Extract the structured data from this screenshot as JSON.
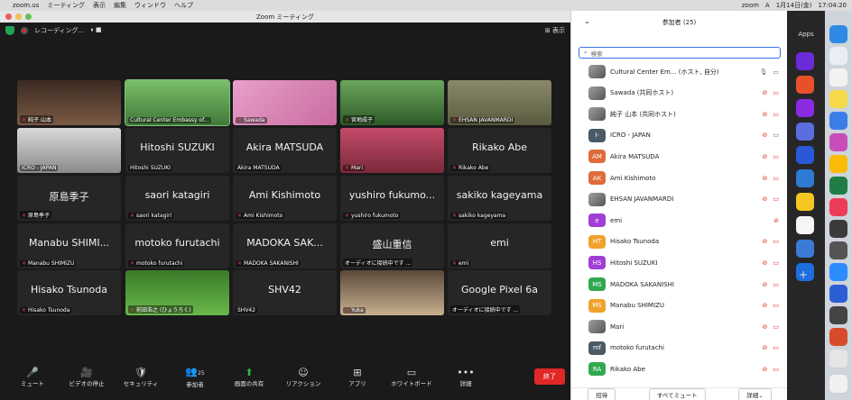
{
  "menubar": {
    "apple": "",
    "items": [
      "zoom.us",
      "ミーティング",
      "表示",
      "編集",
      "ウィンドウ",
      "ヘルプ"
    ],
    "right_items": [
      "zoom",
      "A",
      "1月14日(金)",
      "17:04:20"
    ]
  },
  "window": {
    "title": "Zoom ミーティング"
  },
  "topbar": {
    "recording": "レコーディング...",
    "pause": "⏸ ■",
    "view": "表示"
  },
  "tiles": [
    {
      "big": "",
      "name": "純子 山本",
      "muted": true
    },
    {
      "big": "",
      "name": "Cultural Center Embassy of...",
      "muted": false,
      "highlight": true
    },
    {
      "big": "",
      "name": "Sawada",
      "muted": true
    },
    {
      "big": "",
      "name": "宮地成子",
      "muted": true
    },
    {
      "big": "",
      "name": "EHSAN JAVANMARDI",
      "muted": true
    },
    {
      "big": "",
      "name": "ICRO - JAPAN",
      "muted": false
    },
    {
      "big": "Hitoshi SUZUKI",
      "name": "Hitoshi SUZUKI",
      "muted": false
    },
    {
      "big": "Akira MATSUDA",
      "name": "Akira MATSUDA",
      "muted": false
    },
    {
      "big": "",
      "name": "Mari",
      "muted": true
    },
    {
      "big": "Rikako Abe",
      "name": "Rikako Abe",
      "muted": true
    },
    {
      "big": "原島季子",
      "name": "原島季子",
      "muted": true
    },
    {
      "big": "saori katagiri",
      "name": "saori katagiri",
      "muted": true
    },
    {
      "big": "Ami Kishimoto",
      "name": "Ami Kishimoto",
      "muted": true
    },
    {
      "big": "yushiro fukumo...",
      "name": "yushiro fukumoto",
      "muted": true
    },
    {
      "big": "sakiko kageyama",
      "name": "sakiko kageyama",
      "muted": true
    },
    {
      "big": "Manabu SHIMI...",
      "name": "Manabu SHIMIZU",
      "muted": true
    },
    {
      "big": "motoko furutachi",
      "name": "motoko furutachi",
      "muted": true
    },
    {
      "big": "MADOKA SAK...",
      "name": "MADOKA SAKANISHI",
      "muted": true
    },
    {
      "big": "盛山重信",
      "name": "オーディオに接続中です ...",
      "muted": false
    },
    {
      "big": "emi",
      "name": "emi",
      "muted": true
    },
    {
      "big": "Hisako Tsunoda",
      "name": "Hisako Tsunoda",
      "muted": true
    },
    {
      "big": "",
      "name": "前田浩之 (ひょうろく)",
      "muted": true
    },
    {
      "big": "SHV42",
      "name": "SHV42",
      "muted": false
    },
    {
      "big": "",
      "name": "Yuka",
      "muted": true
    },
    {
      "big": "Google Pixel 6a",
      "name": "オーディオに接続中です ...",
      "muted": false
    }
  ],
  "toolbar": {
    "items": [
      {
        "icon": "🎤",
        "label": "ミュート"
      },
      {
        "icon": "🎥",
        "label": "ビデオの停止"
      },
      {
        "icon": "🛡",
        "label": "セキュリティ"
      },
      {
        "icon": "👥",
        "label": "参加者",
        "count": "25"
      },
      {
        "icon": "⬆",
        "label": "画面の共有"
      },
      {
        "icon": "☺",
        "label": "リアクション"
      },
      {
        "icon": "⊞",
        "label": "アプリ"
      },
      {
        "icon": "▭",
        "label": "ホワイトボード"
      },
      {
        "icon": "•••",
        "label": "詳細"
      }
    ],
    "end": "終了"
  },
  "panel": {
    "title": "参加者 (25)",
    "search_placeholder": "検索",
    "participants": [
      {
        "initials": "",
        "color": "#999999",
        "name": "Cultural Center Em... (ホスト, 自分)",
        "mic": "on",
        "video": "on"
      },
      {
        "initials": "",
        "color": "#999999",
        "name": "Sawada (共同ホスト)",
        "mic": "off",
        "video": "off"
      },
      {
        "initials": "",
        "color": "#999999",
        "name": "純子 山本 (共同ホスト)",
        "mic": "off",
        "video": "off"
      },
      {
        "initials": "I-",
        "color": "#4a5a66",
        "name": "ICRO - JAPAN",
        "mic": "off",
        "video": "on"
      },
      {
        "initials": "AM",
        "color": "#e06b3a",
        "name": "Akira MATSUDA",
        "mic": "off",
        "video": "off"
      },
      {
        "initials": "AK",
        "color": "#e06b3a",
        "name": "Ami Kishimoto",
        "mic": "off",
        "video": "off"
      },
      {
        "initials": "",
        "color": "#999999",
        "name": "EHSAN JAVANMARDI",
        "mic": "off",
        "video": "off"
      },
      {
        "initials": "e",
        "color": "#a13ed6",
        "name": "emi",
        "mic": "off",
        "video": ""
      },
      {
        "initials": "HT",
        "color": "#f0a22a",
        "name": "Hisako Tsunoda",
        "mic": "off",
        "video": "off"
      },
      {
        "initials": "HS",
        "color": "#a13ed6",
        "name": "Hitoshi SUZUKI",
        "mic": "off",
        "video": "off"
      },
      {
        "initials": "MS",
        "color": "#2fa84f",
        "name": "MADOKA SAKANISHI",
        "mic": "off",
        "video": "off"
      },
      {
        "initials": "MS",
        "color": "#f0a22a",
        "name": "Manabu SHIMIZU",
        "mic": "off",
        "video": "off"
      },
      {
        "initials": "",
        "color": "#999999",
        "name": "Mari",
        "mic": "off",
        "video": "off"
      },
      {
        "initials": "mf",
        "color": "#4a5a66",
        "name": "motoko furutachi",
        "mic": "off",
        "video": "off"
      },
      {
        "initials": "RA",
        "color": "#2fa84f",
        "name": "Rikako Abe",
        "mic": "off",
        "video": "off"
      }
    ],
    "footer": {
      "invite": "招待",
      "mute_all": "すべてミュート",
      "more": "詳細⌄"
    }
  },
  "apps": {
    "label": "Apps"
  }
}
